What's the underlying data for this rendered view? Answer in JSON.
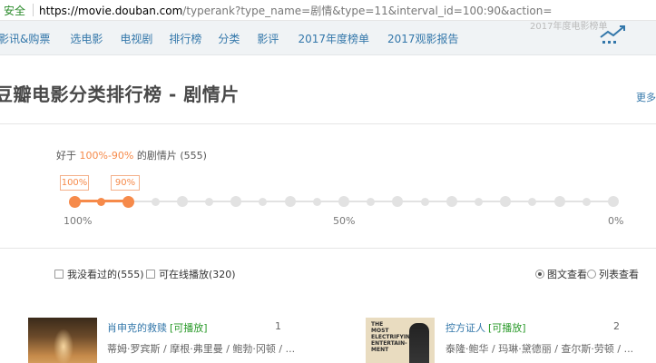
{
  "address_bar": {
    "secure_label": "安全",
    "url_host": "https://movie.douban.com",
    "url_rest": "/typerank?type_name=剧情&type=11&interval_id=100:90&action="
  },
  "nav": {
    "items": [
      "影讯&购票",
      "选电影",
      "电视剧",
      "排行榜",
      "分类",
      "影评",
      "2017年度榜单",
      "2017观影报告"
    ],
    "overflow_text": "2017年度电影榜单"
  },
  "page": {
    "title": "豆瓣电影分类排行榜 - 剧情片",
    "more_link": "更多"
  },
  "filter": {
    "prefix": "好于",
    "range": "100%-90%",
    "suffix": "的剧情片",
    "count": "(555)",
    "tag_high": "100%",
    "tag_low": "90%",
    "scale": [
      "100%",
      "50%",
      "0%"
    ],
    "selected_fraction_start": 1.0,
    "selected_fraction_end": 0.9
  },
  "options": {
    "unwatched": "我没看过的(555)",
    "online": "可在线播放(320)",
    "view_grid": "图文查看",
    "view_list": "列表查看"
  },
  "movies": [
    {
      "rank": "1",
      "title": "肖申克的救赎",
      "play": "[可播放]",
      "actors": "蒂姆·罗宾斯 / 摩根·弗里曼 / 鲍勃·冈顿 / ..."
    },
    {
      "rank": "2",
      "title": "控方证人",
      "play": "[可播放]",
      "actors": "泰隆·鲍华 / 玛琳·黛德丽 / 查尔斯·劳顿 / ..."
    }
  ],
  "colors": {
    "accent": "#f68a4a",
    "link": "#37a",
    "play": "#2a9a2a"
  }
}
